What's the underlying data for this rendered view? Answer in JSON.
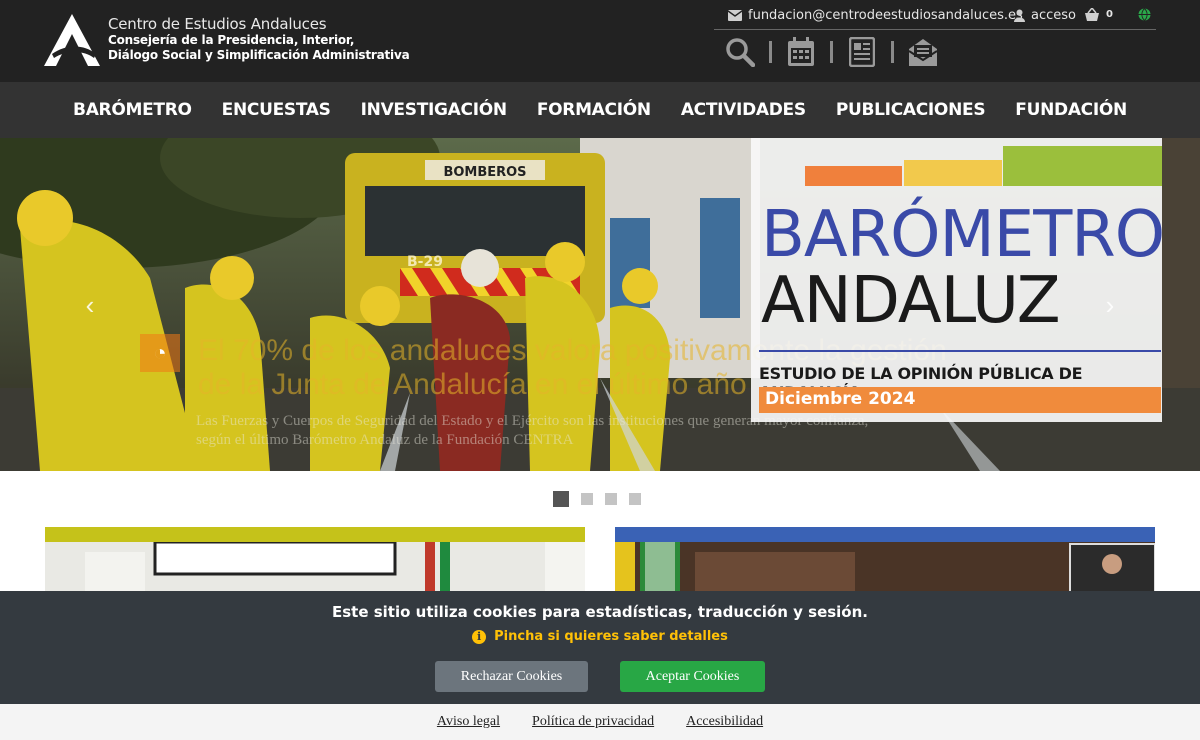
{
  "header": {
    "org_name": "Centro de Estudios Andaluces",
    "dept_line1": "Consejería de la Presidencia, Interior,",
    "dept_line2": "Diálogo Social y Simplificación Administrativa",
    "email": "fundacion@centrodeestudiosandaluces.es",
    "login_label": "acceso",
    "cart_count": "0",
    "icons": [
      "search-icon",
      "calendar-icon",
      "newspaper-icon",
      "newsletter-icon"
    ]
  },
  "nav": {
    "items": [
      "BARÓMETRO",
      "ENCUESTAS",
      "INVESTIGACIÓN",
      "FORMACIÓN",
      "ACTIVIDADES",
      "PUBLICACIONES",
      "FUNDACIÓN"
    ]
  },
  "hero": {
    "caption_title_line1": "El 70% de los andaluces valora positivamente la gestión",
    "caption_title_line2": "de la Junta de Andalucía en el último año",
    "caption_sub_line1": "Las Fuerzas y Cuerpos de Seguridad del Estado y el Ejército son las instituciones que generan mayor confianza,",
    "caption_sub_line2": "según el último Barómetro Andaluz de la Fundación CENTRA",
    "truck_label": "BOMBEROS",
    "truck_plate": "B-29",
    "promo_line1": "BARÓMETRO",
    "promo_line2": "ANDALUZ",
    "promo_study": "ESTUDIO DE LA OPINIÓN PÚBLICA DE ANDALUCÍA",
    "promo_date": "Diciembre 2024",
    "slide_count": 4,
    "active_slide": 1
  },
  "cards": [
    {
      "accent": "#c5c21a"
    },
    {
      "accent": "#3a62b5"
    }
  ],
  "cookie": {
    "message": "Este sitio utiliza cookies para estadísticas, traducción y sesión.",
    "details": "Pincha si quieres saber detalles",
    "reject_label": "Rechazar Cookies",
    "accept_label": "Aceptar Cookies"
  },
  "footer": {
    "links": [
      "Aviso legal",
      "Política de privacidad",
      "Accesibilidad"
    ]
  },
  "colors": {
    "header_bg": "#222222",
    "nav_bg": "#333333",
    "cookie_bg": "#343a40",
    "accept": "#28a745",
    "reject": "#6c757d",
    "details": "#ffc107"
  }
}
